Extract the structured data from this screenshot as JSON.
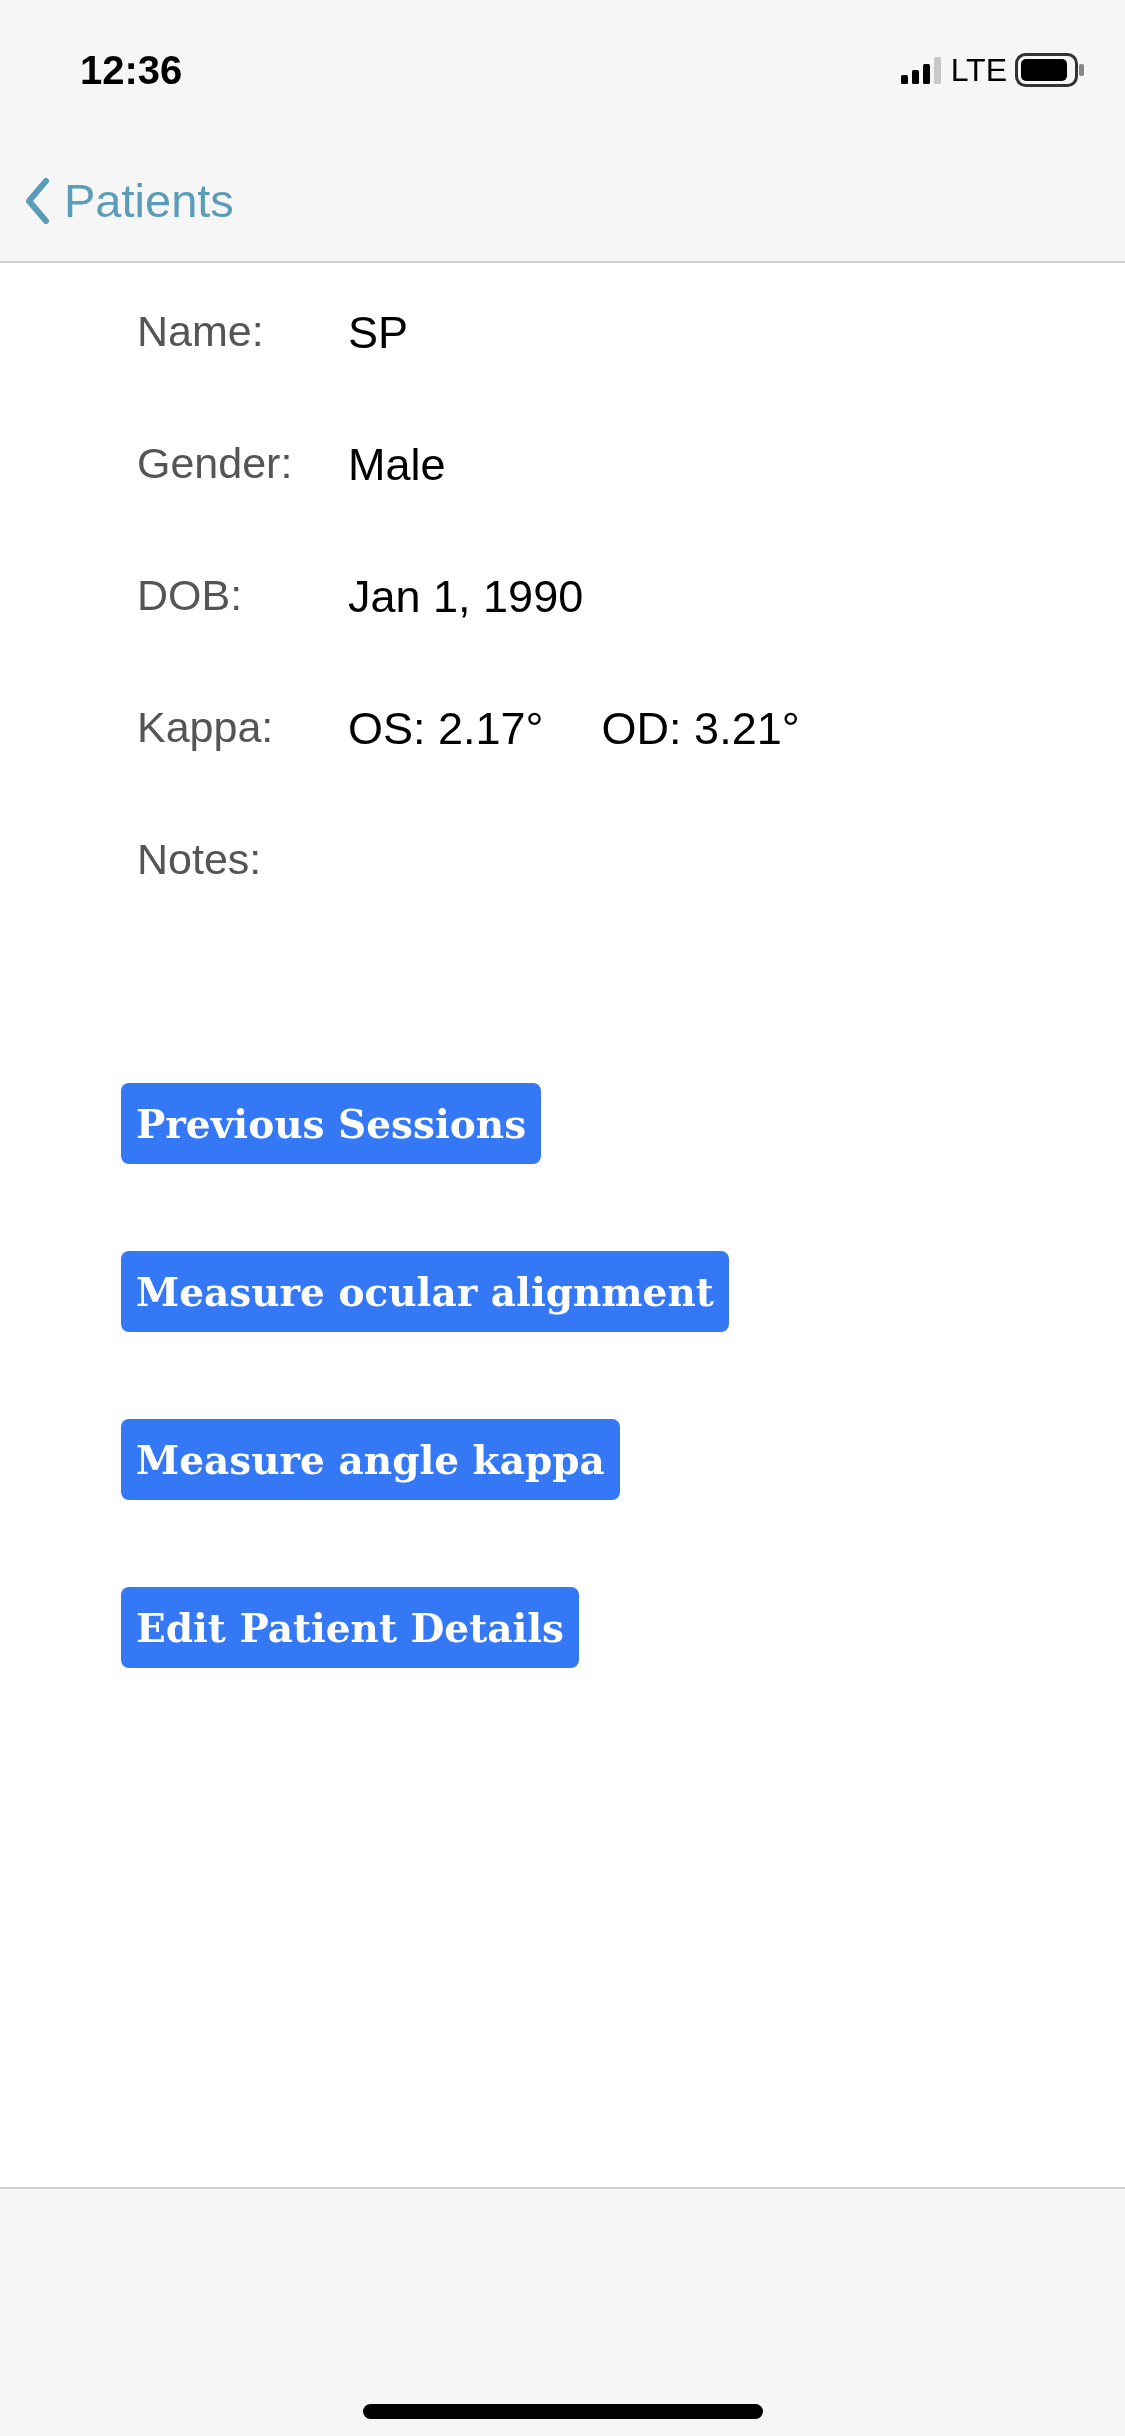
{
  "status_bar": {
    "time": "12:36",
    "network": "LTE"
  },
  "nav": {
    "back_label": "Patients"
  },
  "details": [
    {
      "label": "Name:",
      "values": [
        "SP"
      ]
    },
    {
      "label": "Gender:",
      "values": [
        "Male"
      ]
    },
    {
      "label": "DOB:",
      "values": [
        "Jan 1, 1990"
      ]
    },
    {
      "label": "Kappa:",
      "values": [
        "OS: 2.17°",
        "OD: 3.21°"
      ]
    },
    {
      "label": "Notes:"
    }
  ],
  "buttons": [
    "Previous Sessions",
    "Measure ocular alignment",
    "Measure angle kappa",
    "Edit Patient Details"
  ]
}
